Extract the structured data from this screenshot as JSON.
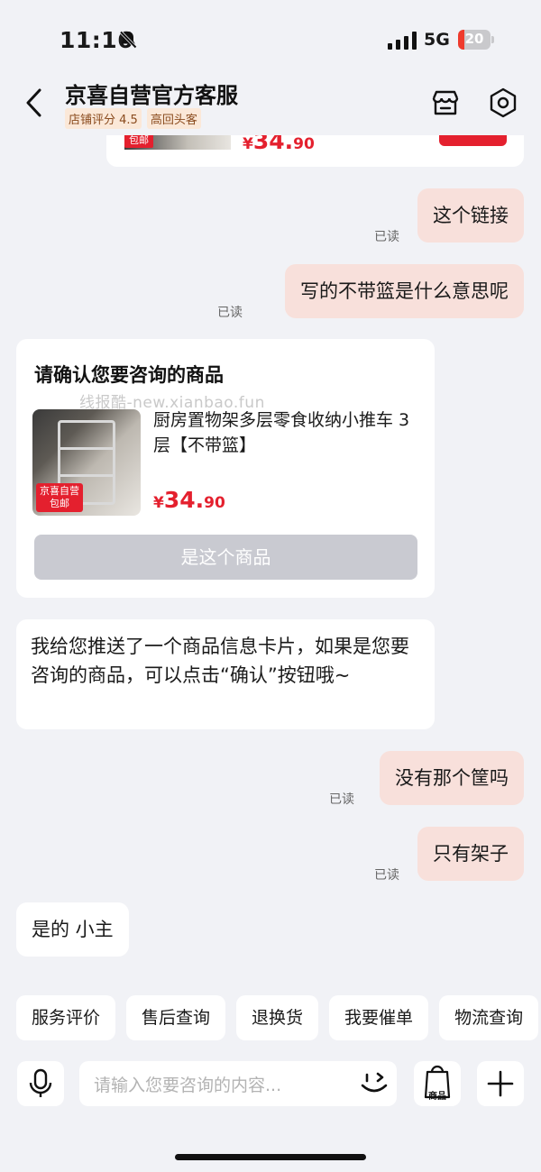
{
  "status_bar": {
    "time": "11:16",
    "network": "5G",
    "battery": "20",
    "battery_fraction": 0.2
  },
  "header": {
    "title": "京喜自营官方客服",
    "tags": [
      "店铺评分 4.5",
      "高回头客"
    ]
  },
  "top_card": {
    "badge": "包邮",
    "price_currency": "¥",
    "price_int": "34.",
    "price_dec": "90"
  },
  "messages": [
    {
      "side": "right",
      "text": "这个链接",
      "status": "已读"
    },
    {
      "side": "right",
      "text": "写的不带篮是什么意思呢",
      "status": "已读"
    }
  ],
  "confirm_card": {
    "title": "请确认您要咨询的商品",
    "watermark": "线报酷-new.xianbao.fun",
    "product_name": "厨房置物架多层零食收纳小推车 3层【不带篮】",
    "thumb_badge": "京喜自营 包邮",
    "price_currency": "¥",
    "price_int": "34.",
    "price_dec": "90",
    "button": "是这个商品"
  },
  "bot_message": "我给您推送了一个商品信息卡片，如果是您要咨询的商品，可以点击“确认”按钮哦~",
  "messages2": [
    {
      "side": "right",
      "text": "没有那个筐吗",
      "status": "已读"
    },
    {
      "side": "right",
      "text": "只有架子",
      "status": "已读"
    }
  ],
  "bot_message2": "是的 小主",
  "quick_actions": [
    "服务评价",
    "售后查询",
    "退换货",
    "我要催单",
    "物流查询"
  ],
  "input": {
    "placeholder": "请输入您要咨询的内容..."
  },
  "goods_button_label": "商品",
  "icons": [
    "bell-mute-icon",
    "signal-icon",
    "back-icon",
    "store-icon",
    "settings-icon",
    "mic-icon",
    "emoji-icon",
    "bag-icon",
    "plus-icon"
  ],
  "colors": {
    "accent_red": "#e4202e",
    "bubble_right": "#f8e0db",
    "background": "#f1f2f6"
  }
}
